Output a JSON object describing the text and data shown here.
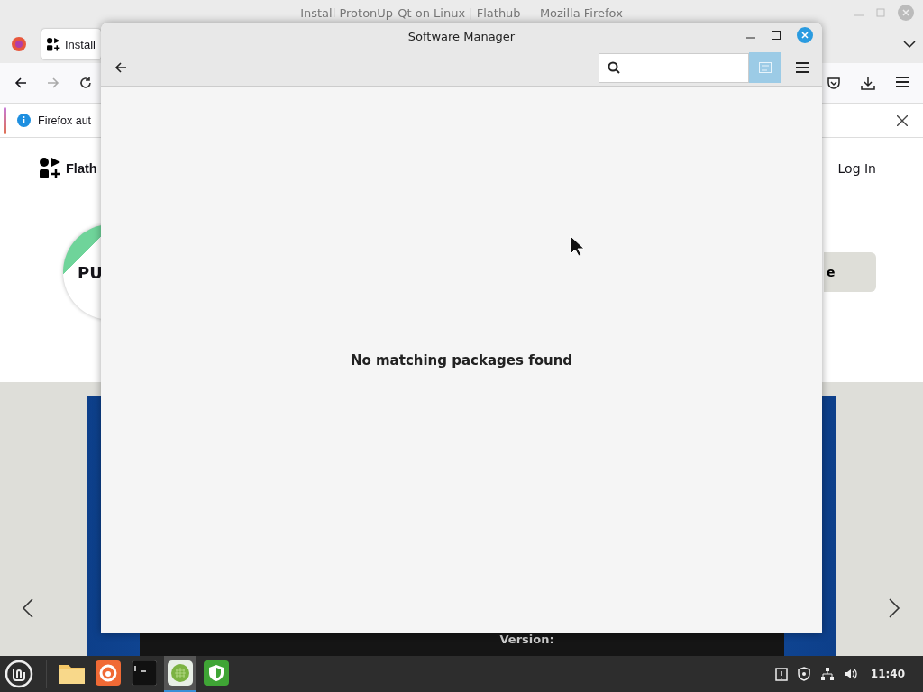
{
  "browser": {
    "title": "Install ProtonUp-Qt on Linux | Flathub — Mozilla Firefox",
    "tabs": [
      {
        "label": "Install",
        "selected": true
      }
    ],
    "notification": "Firefox aut",
    "page": {
      "logo_text": "Flath",
      "login": "Log In",
      "app_badge": "PU",
      "action_button": "e",
      "version_label": "Version:"
    }
  },
  "software_manager": {
    "title": "Software Manager",
    "search": {
      "focused": true
    },
    "filter_toggle": {
      "on": true
    },
    "message": "No matching packages found"
  },
  "taskbar": {
    "apps": [
      {
        "kind": "folder",
        "active": false
      },
      {
        "kind": "browser",
        "active": false
      },
      {
        "kind": "terminal",
        "active": false
      },
      {
        "kind": "grid",
        "active": true
      },
      {
        "kind": "shield",
        "active": false
      }
    ],
    "clock": "11:40"
  }
}
